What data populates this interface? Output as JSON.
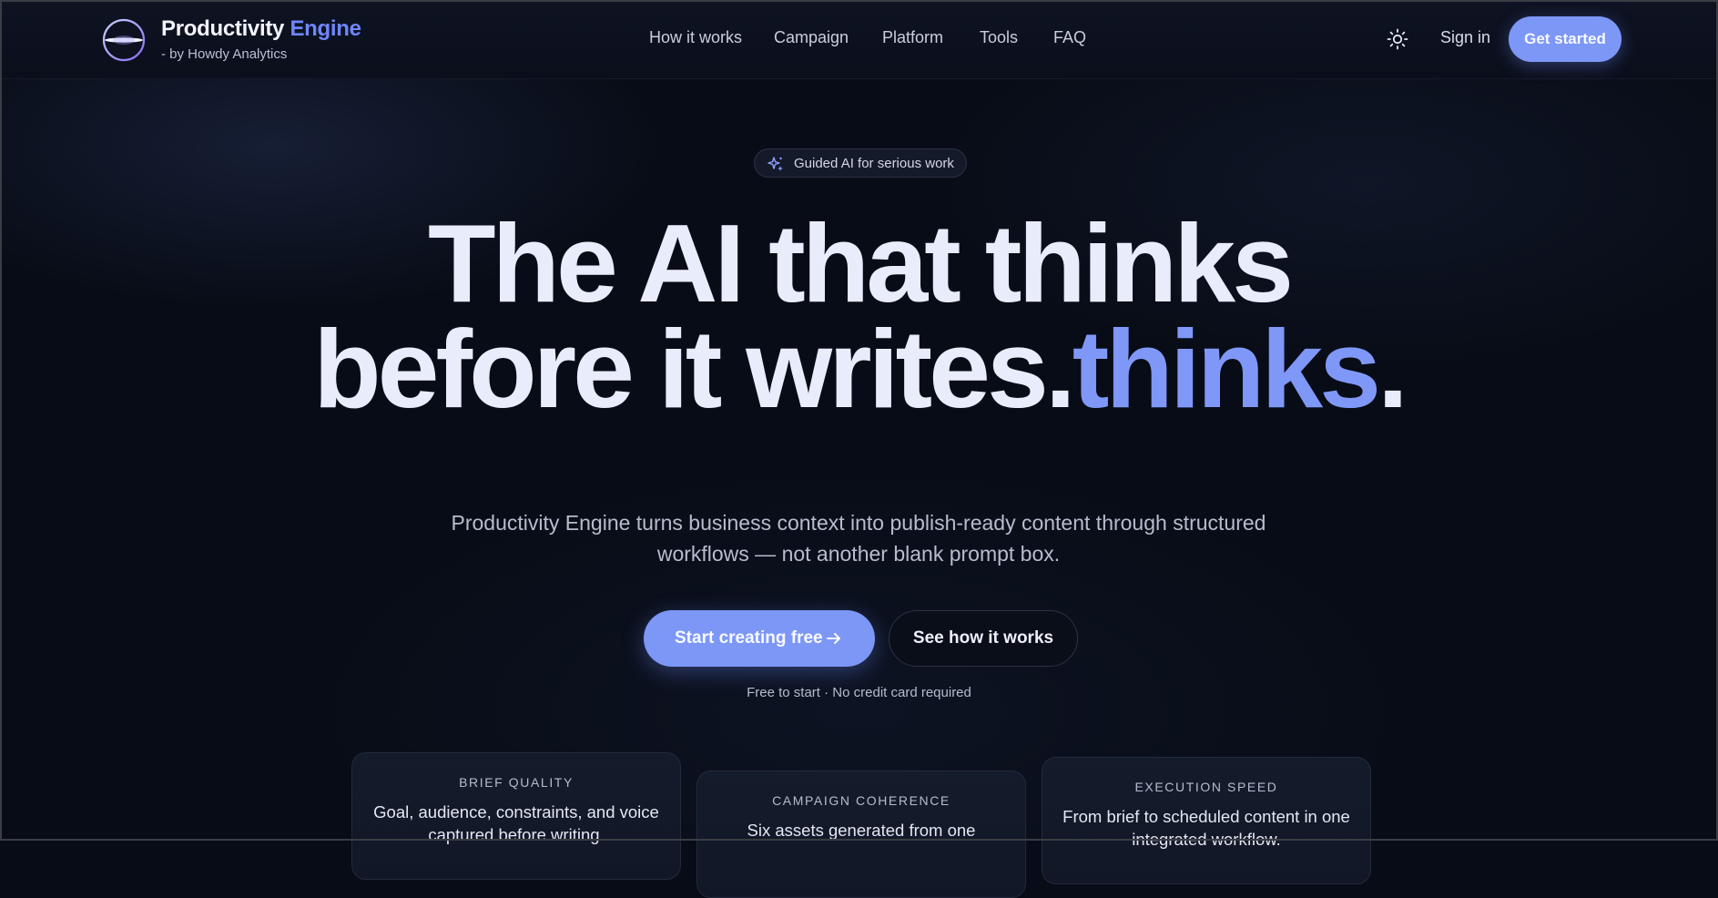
{
  "brand": {
    "name_primary": "Productivity",
    "name_accent": "Engine",
    "subtitle": "- by Howdy Analytics"
  },
  "nav": {
    "items": [
      "How it works",
      "Campaign",
      "Platform",
      "Tools",
      "FAQ"
    ],
    "theme_icon": "sun-icon",
    "sign_in": "Sign in",
    "get_started": "Get started"
  },
  "hero": {
    "badge": "Guided AI for serious work",
    "badge_icon": "sparkles-icon",
    "headline_line1": "The AI that thinks",
    "headline_line2_prefix": "before it writes.",
    "headline_line2_accent": "thinks",
    "headline_line2_suffix": ".",
    "lead": "Productivity Engine turns business context into publish-ready content through structured workflows — not another blank prompt box.",
    "primary_cta": "Start creating free",
    "primary_cta_icon": "arrow-right-icon",
    "secondary_cta": "See how it works",
    "note": "Free to start · No credit card required"
  },
  "cards": [
    {
      "label": "BRIEF QUALITY",
      "body": "Goal, audience, constraints, and voice captured before writing."
    },
    {
      "label": "CAMPAIGN COHERENCE",
      "body": "Six assets generated from one"
    },
    {
      "label": "EXECUTION SPEED",
      "body": "From brief to scheduled content in one integrated workflow."
    }
  ],
  "colors": {
    "background": "#080c16",
    "accent": "#7d97f7",
    "brand_accent": "#6f86ff",
    "text": "#e9ecfb"
  }
}
